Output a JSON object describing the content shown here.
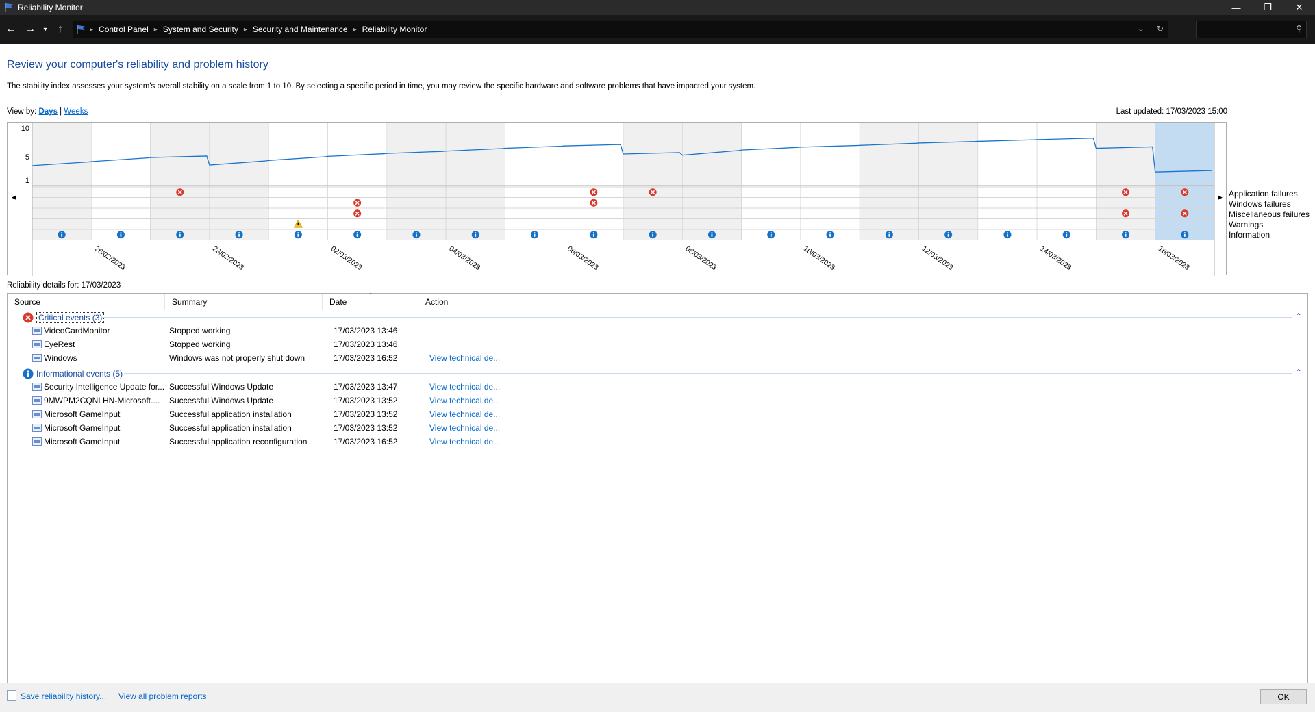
{
  "window": {
    "title": "Reliability Monitor"
  },
  "breadcrumbs": [
    "Control Panel",
    "System and Security",
    "Security and Maintenance",
    "Reliability Monitor"
  ],
  "page": {
    "heading": "Review your computer's reliability and problem history",
    "description": "The stability index assesses your system's overall stability on a scale from 1 to 10. By selecting a specific period in time, you may review the specific hardware and software problems that have impacted your system.",
    "view_by_label": "View by:",
    "view_days": "Days",
    "view_sep": "|",
    "view_weeks": "Weeks",
    "last_updated": "Last updated: 17/03/2023 15:00"
  },
  "chart_data": {
    "type": "line",
    "y_ticks": [
      "10",
      "5",
      "1"
    ],
    "ylim": [
      1,
      10
    ],
    "row_labels": [
      "Application failures",
      "Windows failures",
      "Miscellaneous failures",
      "Warnings",
      "Information"
    ],
    "date_labels": [
      "26/02/2023",
      "28/02/2023",
      "02/03/2023",
      "04/03/2023",
      "06/03/2023",
      "08/03/2023",
      "10/03/2023",
      "12/03/2023",
      "14/03/2023",
      "16/03/2023"
    ],
    "columns": 20,
    "selected_column": 19,
    "stability": [
      3.5,
      4.2,
      4.9,
      3.6,
      4.4,
      5.1,
      5.6,
      6.0,
      6.5,
      6.9,
      5.5,
      5.3,
      6.2,
      6.7,
      7.0,
      7.4,
      7.7,
      8.0,
      6.5,
      2.4
    ],
    "events": {
      "application_failures": [
        2,
        9,
        10,
        18,
        19
      ],
      "windows_failures": [
        5,
        9
      ],
      "misc_failures": [
        5,
        18,
        19
      ],
      "warnings": [
        4
      ],
      "information": [
        0,
        1,
        2,
        3,
        4,
        5,
        6,
        7,
        8,
        9,
        10,
        11,
        12,
        13,
        14,
        15,
        16,
        17,
        18,
        19
      ]
    },
    "colors": {
      "line": "#1874cd",
      "critical": "#d9382c",
      "info": "#1671c8",
      "warning": "#f2c40f",
      "selected": "#c3dcf2",
      "shaded": "#f0f0f0"
    }
  },
  "details": {
    "label": "Reliability details for: 17/03/2023",
    "columns": [
      "Source",
      "Summary",
      "Date",
      "Action"
    ],
    "critical_group": "Critical events (3)",
    "info_group": "Informational events (5)",
    "critical_rows": [
      {
        "source": "VideoCardMonitor",
        "summary": "Stopped working",
        "date": "17/03/2023 13:46",
        "action": ""
      },
      {
        "source": "EyeRest",
        "summary": "Stopped working",
        "date": "17/03/2023 13:46",
        "action": ""
      },
      {
        "source": "Windows",
        "summary": "Windows was not properly shut down",
        "date": "17/03/2023 16:52",
        "action": "View technical de..."
      }
    ],
    "info_rows": [
      {
        "source": "Security Intelligence Update for...",
        "summary": "Successful Windows Update",
        "date": "17/03/2023 13:47",
        "action": "View technical de..."
      },
      {
        "source": "9MWPM2CQNLHN-Microsoft....",
        "summary": "Successful Windows Update",
        "date": "17/03/2023 13:52",
        "action": "View technical de..."
      },
      {
        "source": "Microsoft GameInput",
        "summary": "Successful application installation",
        "date": "17/03/2023 13:52",
        "action": "View technical de..."
      },
      {
        "source": "Microsoft GameInput",
        "summary": "Successful application installation",
        "date": "17/03/2023 13:52",
        "action": "View technical de..."
      },
      {
        "source": "Microsoft GameInput",
        "summary": "Successful application reconfiguration",
        "date": "17/03/2023 16:52",
        "action": "View technical de..."
      }
    ]
  },
  "footer": {
    "save_link": "Save reliability history...",
    "reports_link": "View all problem reports",
    "ok": "OK"
  }
}
